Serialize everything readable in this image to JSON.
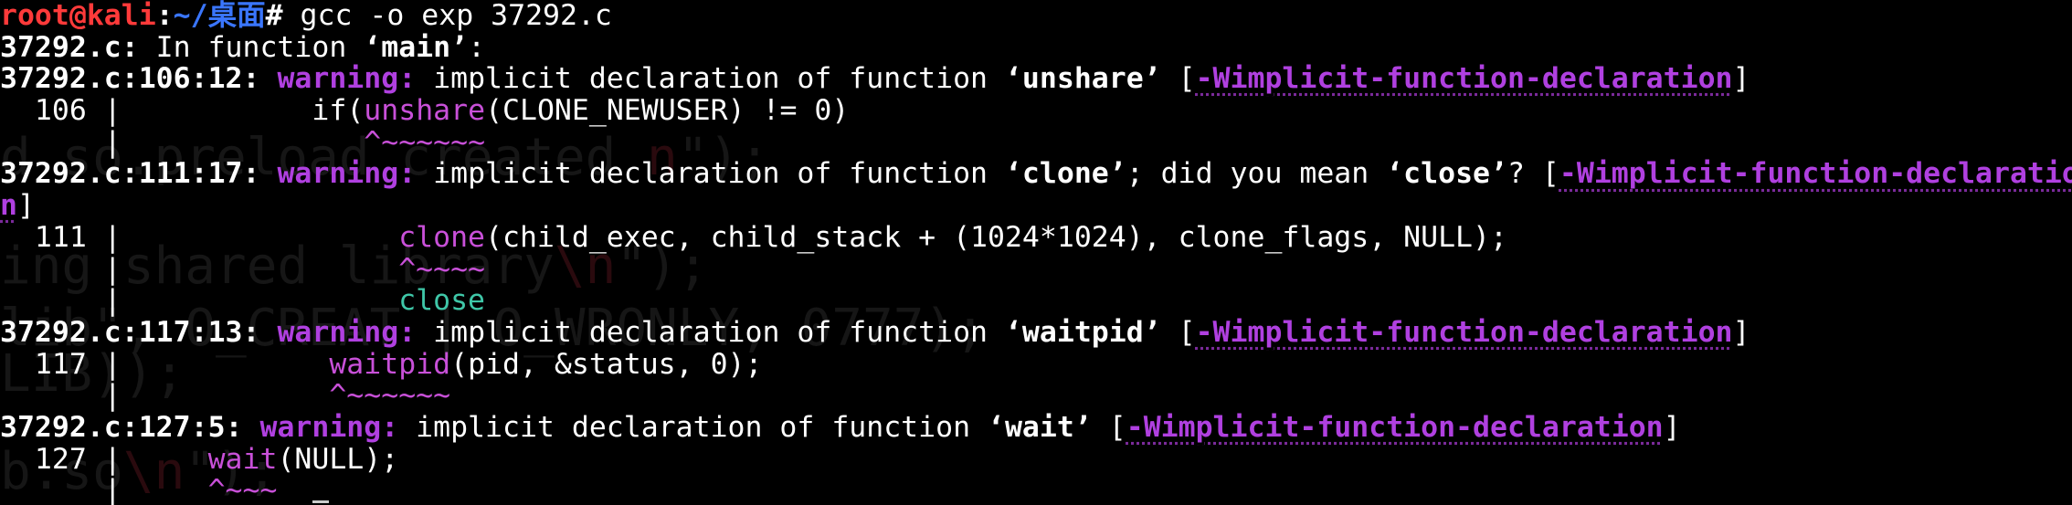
{
  "terminal": {
    "prompt": {
      "user_host": "root@kali",
      "sep": ":",
      "path": "~/桌面",
      "symbol": "# ",
      "command": "gcc -o exp 37292.c"
    },
    "in_function": {
      "file": "37292.c:",
      "text_a": " In function ",
      "name": "‘main’",
      "text_b": ":"
    },
    "warnings": [
      {
        "loc": "37292.c:106:12:",
        "label": "warning:",
        "text_a": " implicit declaration of function ",
        "func": "‘unshare’",
        "text_b": " [",
        "flag": "-Wimplicit-function-declaration",
        "text_c": "]",
        "line_no": "  106 |",
        "code_indent": "           ",
        "code_hl": "unshare",
        "code_pre": "if(",
        "code_rest": "(CLONE_NEWUSER) != 0)",
        "caret_gutter": "      |",
        "caret_pad": "              ",
        "caret": "^~~~~~~"
      },
      {
        "loc": "37292.c:111:17:",
        "label": "warning:",
        "text_a": " implicit declaration of function ",
        "func": "‘clone’",
        "text_b": "; did you mean ",
        "suggest": "‘close’",
        "text_c": "? [",
        "flag_part1": "-Wimplicit-function-declaratio",
        "flag_part2": "n",
        "text_d": "]",
        "line_no": "  111 |",
        "code_indent": "                ",
        "code_hl": "clone",
        "code_rest": "(child_exec, child_stack + (1024*1024), clone_flags, NULL);",
        "caret_gutter": "      |",
        "caret_pad": "                ",
        "caret": "^~~~~",
        "fix_gutter": "      |",
        "fix_pad": "                ",
        "fix": "close"
      },
      {
        "loc": "37292.c:117:13:",
        "label": "warning:",
        "text_a": " implicit declaration of function ",
        "func": "‘waitpid’",
        "text_b": " [",
        "flag": "-Wimplicit-function-declaration",
        "text_c": "]",
        "line_no": "  117 |",
        "code_indent": "            ",
        "code_hl": "waitpid",
        "code_rest": "(pid, &status, 0);",
        "caret_gutter": "      |",
        "caret_pad": "            ",
        "caret": "^~~~~~~"
      },
      {
        "loc": "37292.c:127:5:",
        "label": "warning:",
        "text_a": " implicit declaration of function ",
        "func": "‘wait’",
        "text_b": " [",
        "flag": "-Wimplicit-function-declaration",
        "text_c": "]",
        "line_no": "  127 |",
        "code_indent": "     ",
        "code_hl": "wait",
        "code_rest": "(NULL);",
        "caret_gutter": "      |",
        "caret_pad": "     ",
        "caret": "^~~~"
      }
    ],
    "background_ghost": {
      "line1_a": "d so.preload created ",
      "line1_b": "n",
      "line1_c": "\");",
      "line2_a": "ing shared library",
      "line2_b": "\\n",
      "line2_c": "\");",
      "line3": "lib\", O_CREAT | O_WRONLY, 0777);",
      "line4": "LIB));",
      "line5_a": "b.so",
      "line5_b": "\\n",
      "line5_c": "\");"
    },
    "colors": {
      "background": "#000000",
      "prompt_user": "#ff3a3a",
      "prompt_path": "#3a76ff",
      "warning": "#b040e0",
      "fixit": "#3fc7a8"
    }
  }
}
